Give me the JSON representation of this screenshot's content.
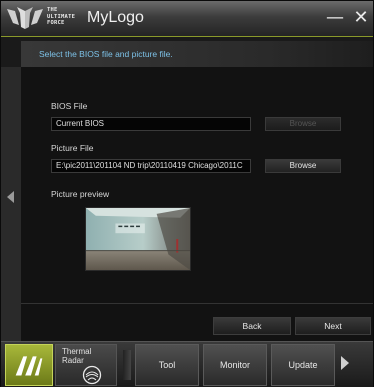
{
  "window": {
    "brand_lines": [
      "THE",
      "ULTIMATE",
      "FORCE"
    ],
    "title": "MyLogo",
    "minimize_glyph": "—",
    "close_glyph": "✕"
  },
  "instruction": "Select the BIOS file and picture file.",
  "bios": {
    "label": "BIOS File",
    "value": "Current BIOS",
    "button_label": "Browse",
    "button_enabled": false
  },
  "picture": {
    "label": "Picture File",
    "value": "E:\\pic2011\\201104 ND trip\\20110419 Chicago\\2011C",
    "button_label": "Browse"
  },
  "preview": {
    "label": "Picture preview"
  },
  "navigation": {
    "back_label": "Back",
    "next_label": "Next"
  },
  "dock": {
    "thermal_label": "Thermal Radar",
    "items": [
      "Tool",
      "Monitor",
      "Update"
    ]
  },
  "colors": {
    "accent": "#a8b83a",
    "instruction_text": "#7dc2e8",
    "background": "#121212"
  },
  "icons": {
    "logo": "tuf-claw-logo",
    "dock_logo": "tuf-ai-logo",
    "thermal": "thermal-radar-icon",
    "left_nav": "arrow-left-icon",
    "dock_more": "arrow-right-icon"
  }
}
